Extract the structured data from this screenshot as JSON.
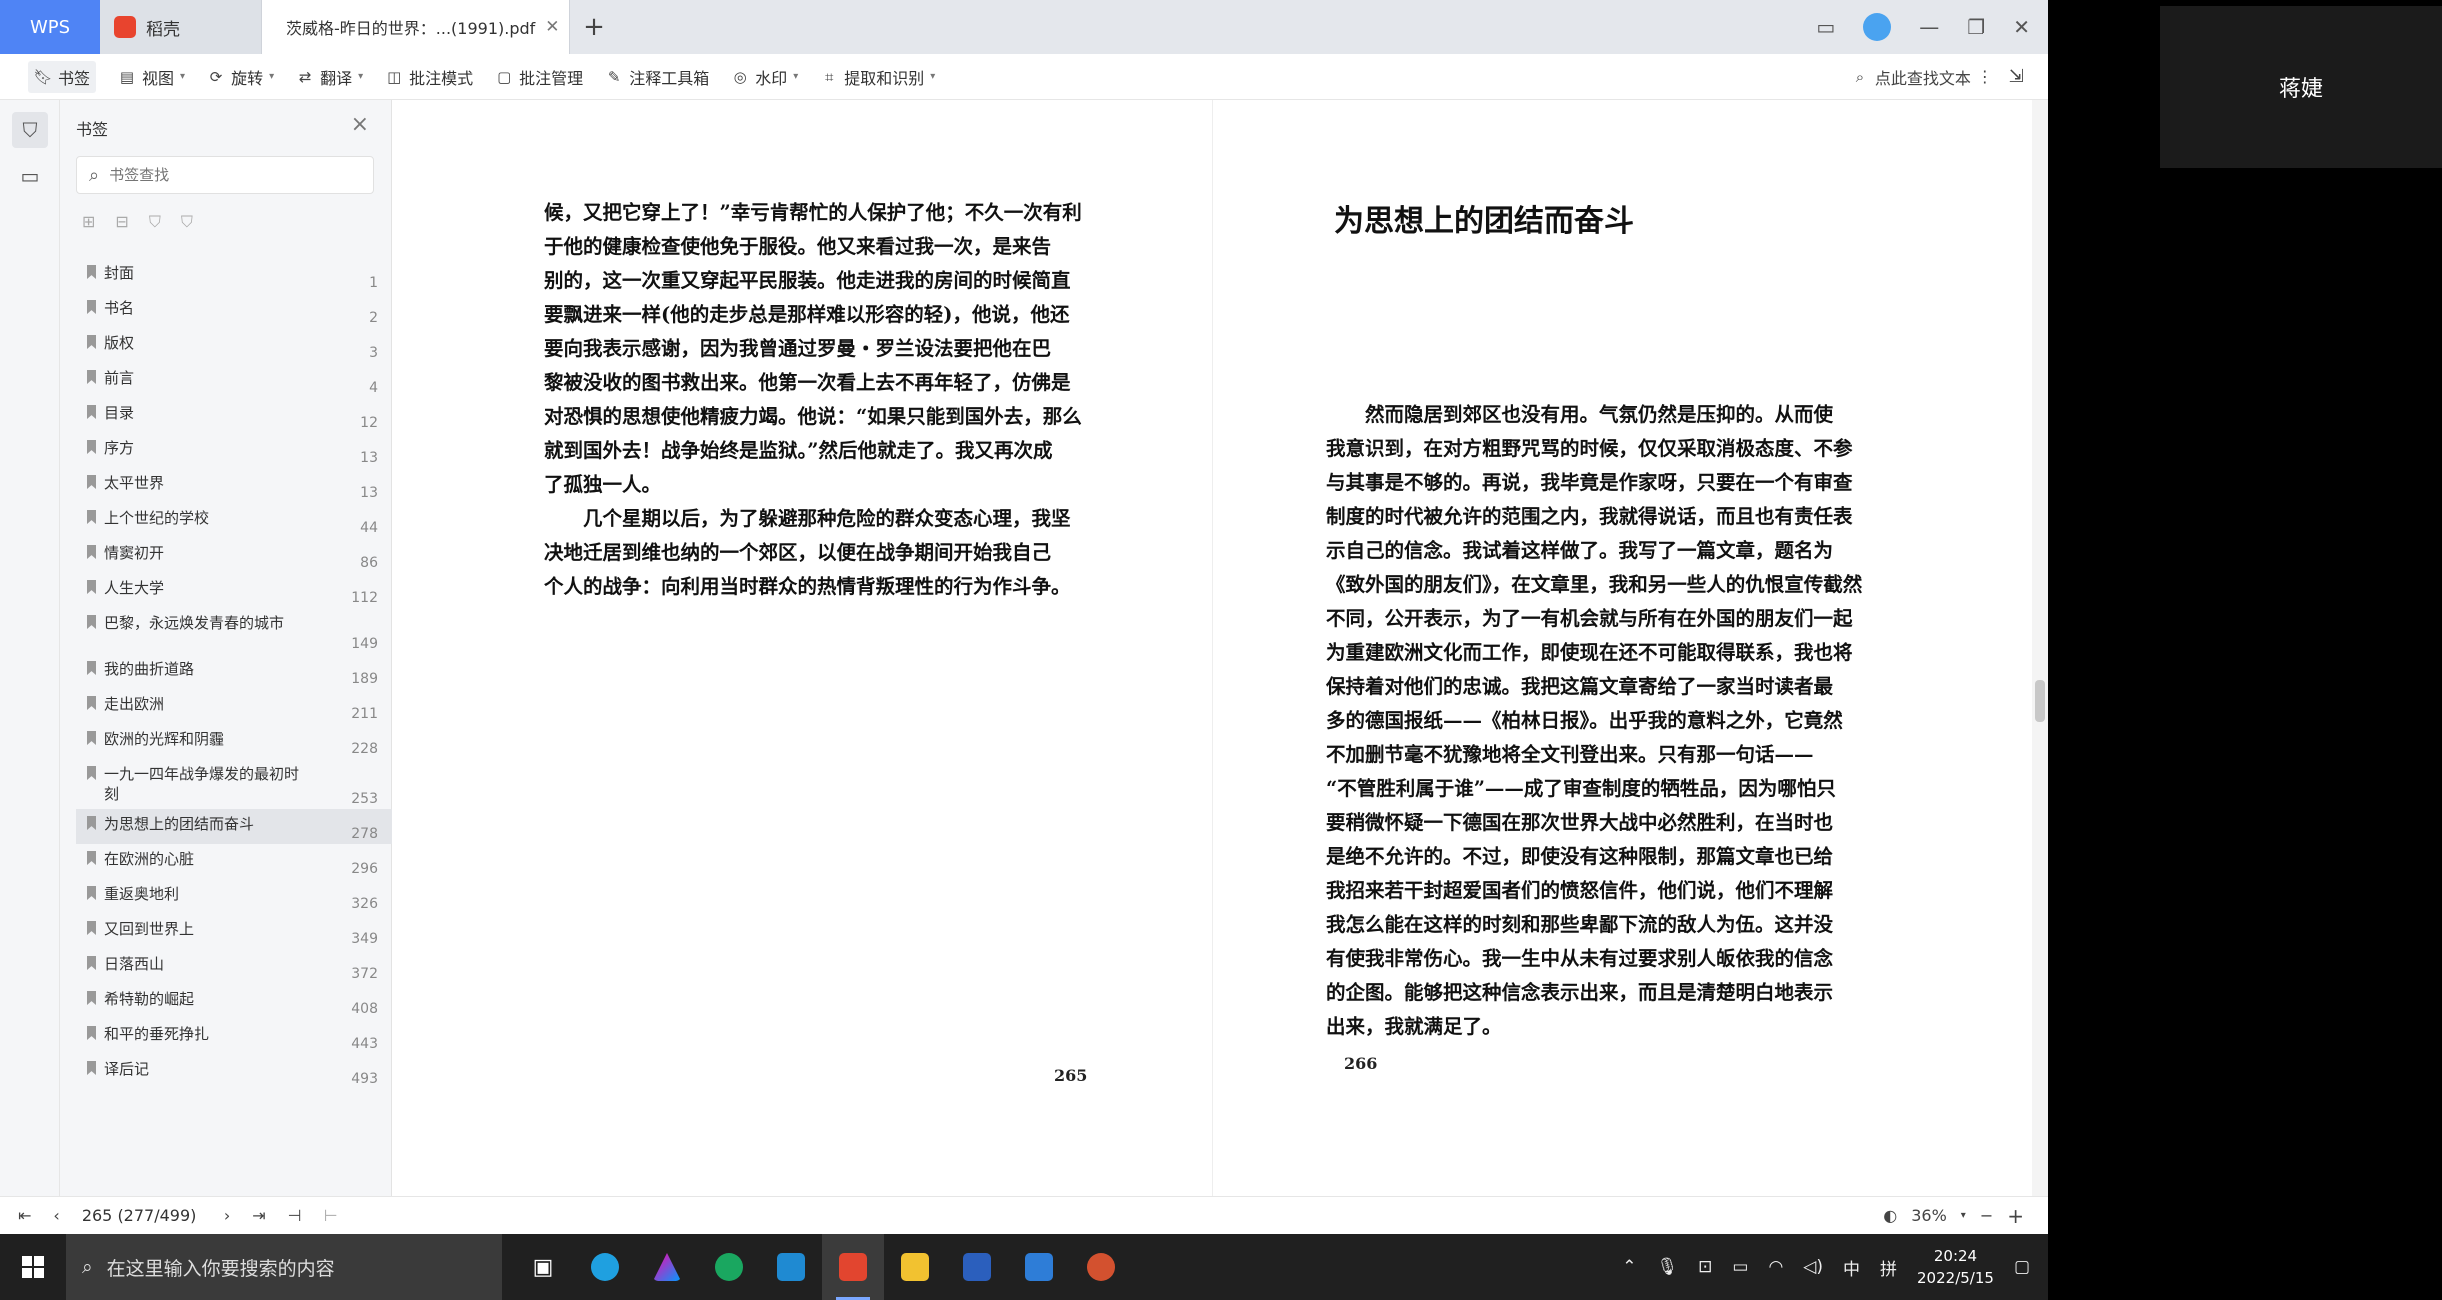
{
  "titlebar": {
    "wps": "WPS",
    "tab1": "稻壳",
    "tab2": "茨威格-昨日的世界：...(1991).pdf"
  },
  "toolbar": {
    "items": [
      "书签",
      "视图",
      "旋转",
      "翻译",
      "批注模式",
      "批注管理",
      "注释工具箱",
      "水印",
      "提取和识别"
    ],
    "search_label": "点此查找文本"
  },
  "panel": {
    "title": "书签",
    "search_placeholder": "书签查找",
    "bookmarks": [
      {
        "label": "封面",
        "page": "1"
      },
      {
        "label": "书名",
        "page": "2"
      },
      {
        "label": "版权",
        "page": "3"
      },
      {
        "label": "前言",
        "page": "4"
      },
      {
        "label": "目录",
        "page": "12"
      },
      {
        "label": "序方",
        "page": "13"
      },
      {
        "label": "太平世界",
        "page": "13"
      },
      {
        "label": "上个世纪的学校",
        "page": "44"
      },
      {
        "label": "情窦初开",
        "page": "86"
      },
      {
        "label": "人生大学",
        "page": "112"
      },
      {
        "label": "巴黎，永远焕发青春的城市",
        "page": "149"
      },
      {
        "label": "我的曲折道路",
        "page": "189"
      },
      {
        "label": "走出欧洲",
        "page": "211"
      },
      {
        "label": "欧洲的光辉和阴霾",
        "page": "228"
      },
      {
        "label": "一九一四年战争爆发的最初时刻",
        "page": "253"
      },
      {
        "label": "为思想上的团结而奋斗",
        "page": "278"
      },
      {
        "label": "在欧洲的心脏",
        "page": "296"
      },
      {
        "label": "重返奥地利",
        "page": "326"
      },
      {
        "label": "又回到世界上",
        "page": "349"
      },
      {
        "label": "日落西山",
        "page": "372"
      },
      {
        "label": "希特勒的崛起",
        "page": "408"
      },
      {
        "label": "和平的垂死挣扎",
        "page": "443"
      },
      {
        "label": "译后记",
        "page": "493"
      }
    ],
    "active_index": 15
  },
  "doc": {
    "left_lines": [
      "候，又把它穿上了！”幸亏肯帮忙的人保护了他；不久一次有利",
      "于他的健康检查使他免于服役。他又来看过我一次，是来告",
      "别的，这一次重又穿起平民服装。他走进我的房间的时候简直",
      "要飘进来一样(他的走步总是那样难以形容的轻)，他说，他还",
      "要向我表示感谢，因为我曾通过罗曼・罗兰设法要把他在巴",
      "黎被没收的图书救出来。他第一次看上去不再年轻了，仿佛是",
      "对恐惧的思想使他精疲力竭。他说：“如果只能到国外去，那么",
      "就到国外去！战争始终是监狱。”然后他就走了。我又再次成",
      "了孤独一人。",
      "　　几个星期以后，为了躲避那种危险的群众变态心理，我坚",
      "决地迁居到维也纳的一个郊区，以便在战争期间开始我自己",
      "个人的战争：向利用当时群众的热情背叛理性的行为作斗争。"
    ],
    "left_page_num": "265",
    "chapter_title": "为思想上的团结而奋斗",
    "right_lines": [
      "　　然而隐居到郊区也没有用。气氛仍然是压抑的。从而使",
      "我意识到，在对方粗野咒骂的时候，仅仅采取消极态度、不参",
      "与其事是不够的。再说，我毕竟是作家呀，只要在一个有审查",
      "制度的时代被允许的范围之内，我就得说话，而且也有责任表",
      "示自己的信念。我试着这样做了。我写了一篇文章，题名为",
      "《致外国的朋友们》，在文章里，我和另一些人的仇恨宣传截然",
      "不同，公开表示，为了一有机会就与所有在外国的朋友们一起",
      "为重建欧洲文化而工作，即使现在还不可能取得联系，我也将",
      "保持着对他们的忠诚。我把这篇文章寄给了一家当时读者最",
      "多的德国报纸——《柏林日报》。出乎我的意料之外，它竟然",
      "不加删节毫不犹豫地将全文刊登出来。只有那一句话——",
      "“不管胜利属于谁”——成了审查制度的牺牲品，因为哪怕只",
      "要稍微怀疑一下德国在那次世界大战中必然胜利，在当时也",
      "是绝不允许的。不过，即使没有这种限制，那篇文章也已给",
      "我招来若干封超爱国者们的愤怒信件，他们说，他们不理解",
      "我怎么能在这样的时刻和那些卑鄙下流的敌人为伍。这并没",
      "有使我非常伤心。我一生中从未有过要求别人皈依我的信念",
      "的企图。能够把这种信念表示出来，而且是清楚明白地表示",
      "出来，我就满足了。"
    ],
    "right_page_num": "266"
  },
  "statusbar": {
    "page_indicator": "265 (277/499)",
    "zoom": "36%"
  },
  "taskbar": {
    "search_placeholder": "在这里输入你要搜索的内容",
    "ime": "中",
    "ime2": "拼",
    "time": "20:24",
    "date": "2022/5/15"
  },
  "namecard": {
    "name": "蒋婕"
  },
  "colors": {
    "wps_blue": "#4f84f5",
    "taskbar": "#202020"
  }
}
